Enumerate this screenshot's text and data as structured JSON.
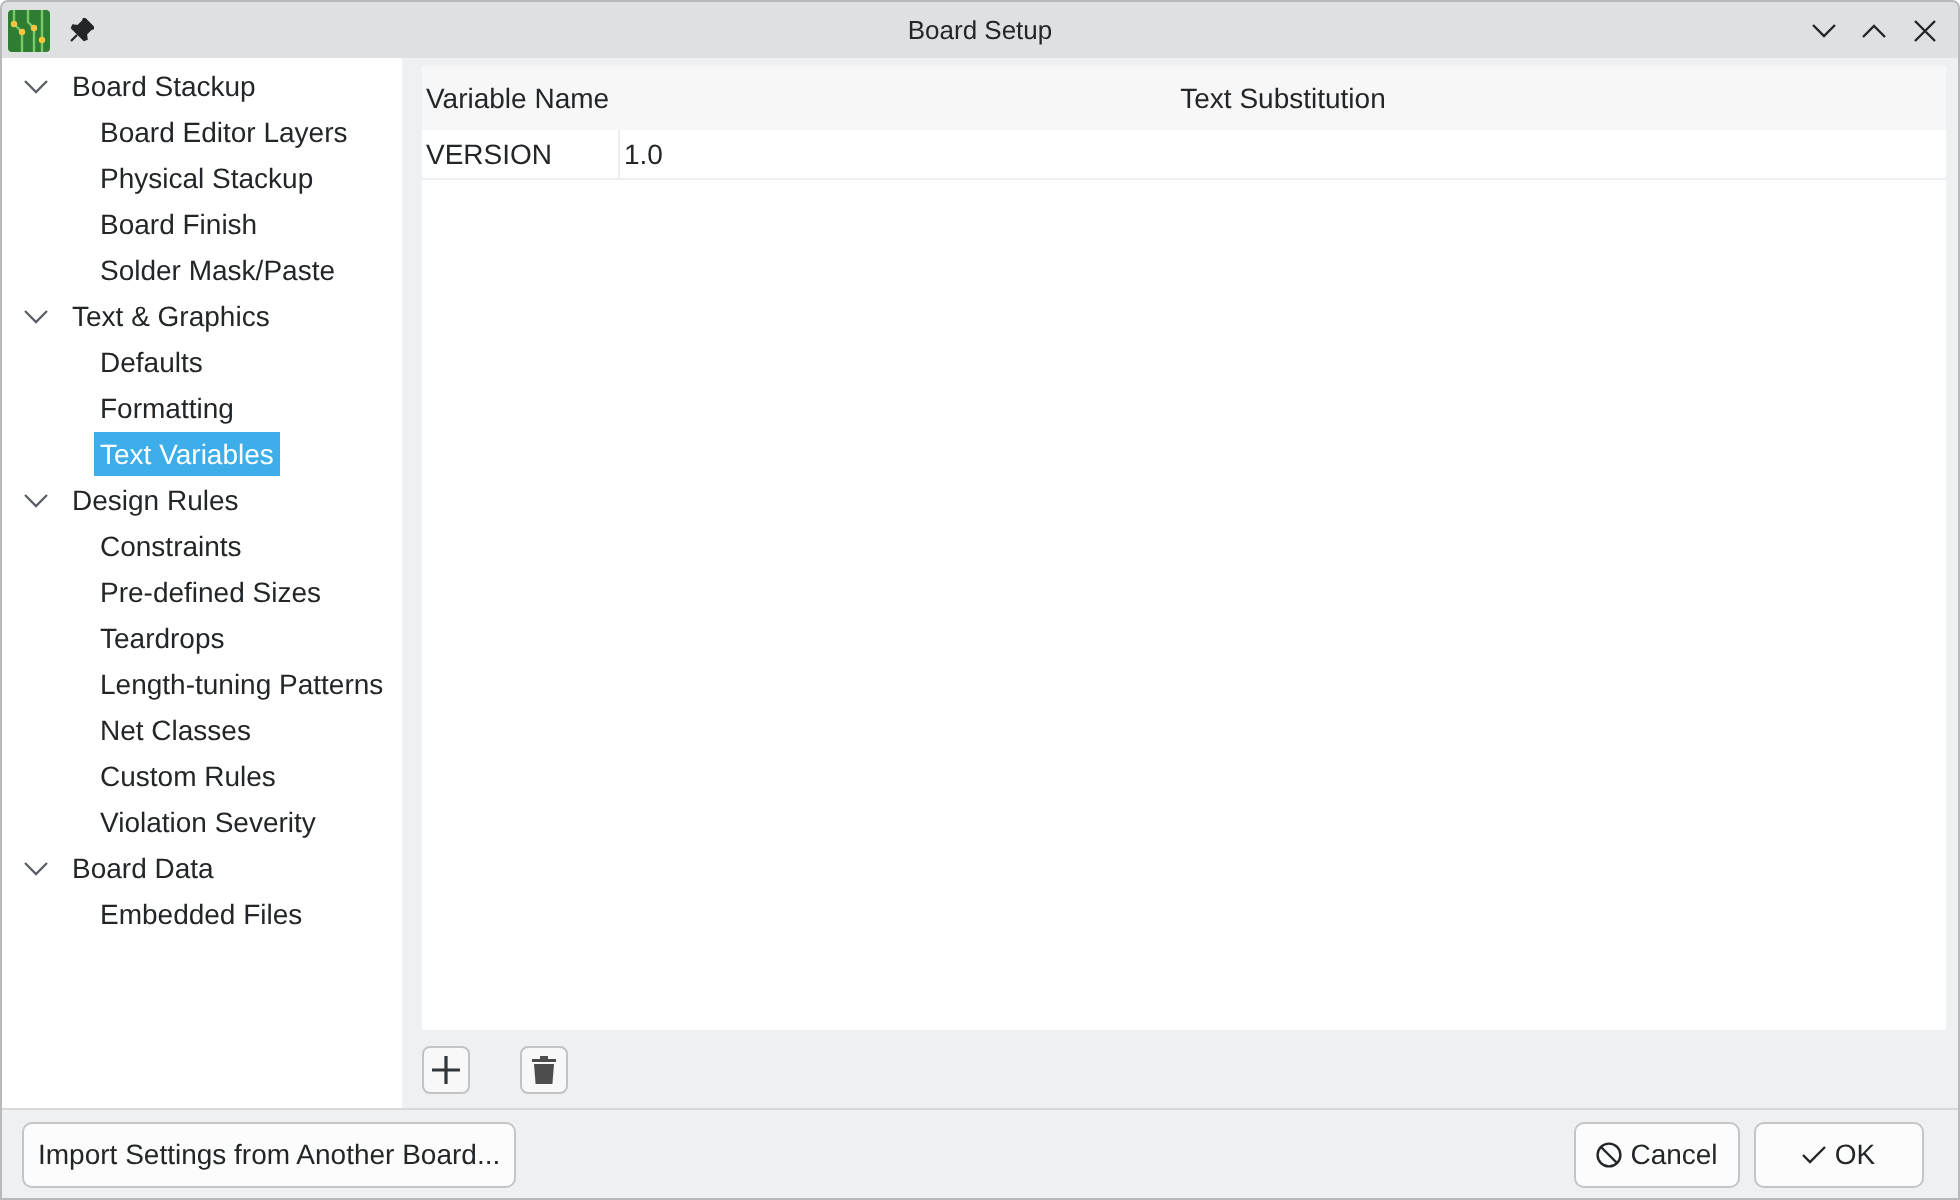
{
  "window": {
    "title": "Board Setup"
  },
  "sidebar": {
    "items": [
      {
        "label": "Board Stackup",
        "expanded": true,
        "selected": false,
        "children": [
          {
            "label": "Board Editor Layers",
            "selected": false
          },
          {
            "label": "Physical Stackup",
            "selected": false
          },
          {
            "label": "Board Finish",
            "selected": false
          },
          {
            "label": "Solder Mask/Paste",
            "selected": false
          }
        ]
      },
      {
        "label": "Text & Graphics",
        "expanded": true,
        "selected": false,
        "children": [
          {
            "label": "Defaults",
            "selected": false
          },
          {
            "label": "Formatting",
            "selected": false
          },
          {
            "label": "Text Variables",
            "selected": true
          }
        ]
      },
      {
        "label": "Design Rules",
        "expanded": true,
        "selected": false,
        "children": [
          {
            "label": "Constraints",
            "selected": false
          },
          {
            "label": "Pre-defined Sizes",
            "selected": false
          },
          {
            "label": "Teardrops",
            "selected": false
          },
          {
            "label": "Length-tuning Patterns",
            "selected": false
          },
          {
            "label": "Net Classes",
            "selected": false
          },
          {
            "label": "Custom Rules",
            "selected": false
          },
          {
            "label": "Violation Severity",
            "selected": false
          }
        ]
      },
      {
        "label": "Board Data",
        "expanded": true,
        "selected": false,
        "children": [
          {
            "label": "Embedded Files",
            "selected": false
          }
        ]
      }
    ]
  },
  "table": {
    "columns": [
      "Variable Name",
      "Text Substitution"
    ],
    "rows": [
      [
        "VERSION",
        "1.0"
      ]
    ]
  },
  "table_actions": [
    {
      "kind": "add"
    },
    {
      "kind": "delete"
    }
  ],
  "footer": {
    "import_button": "Import Settings from Another Board...",
    "buttons": [
      {
        "kind": "cancel",
        "label": "Cancel"
      },
      {
        "kind": "ok",
        "label": "OK"
      }
    ]
  }
}
